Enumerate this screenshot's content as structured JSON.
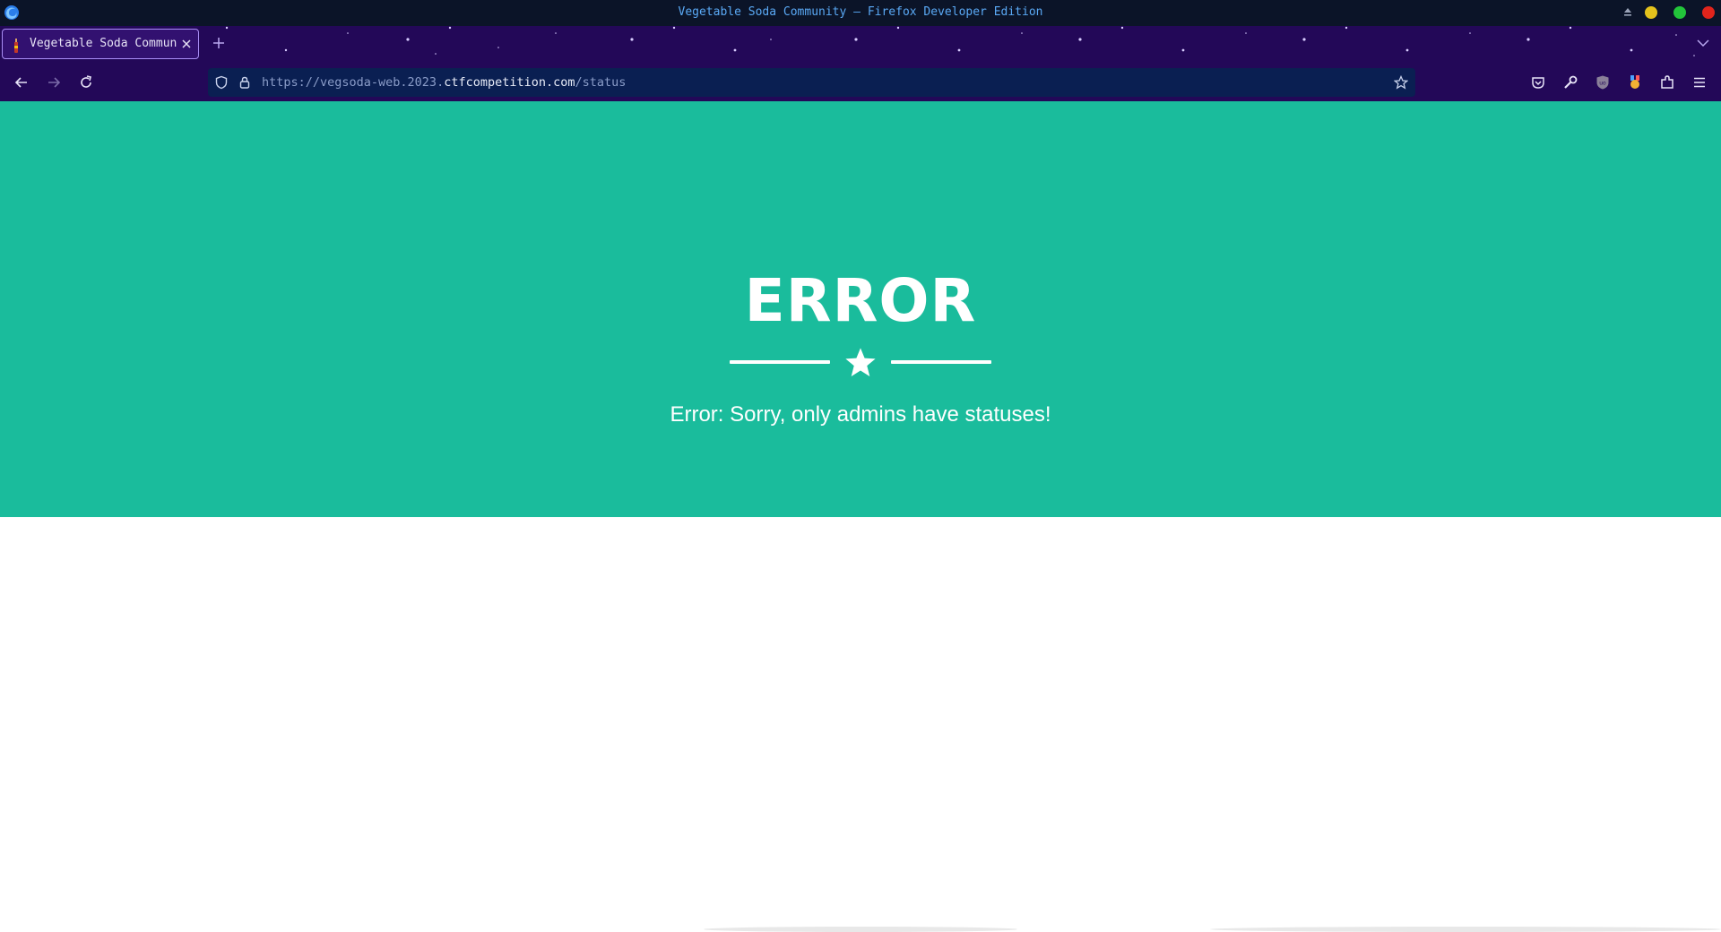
{
  "window": {
    "title": "Vegetable Soda Community — Firefox Developer Edition",
    "controls": [
      "eject-icon",
      "minimize-button",
      "maximize-button",
      "close-button"
    ]
  },
  "colors": {
    "titlebar_bg": "#0b1428",
    "toolbar_bg": "#230858",
    "urlbar_bg": "#0a1f52",
    "hero_bg": "#1abc9c",
    "minimize": "#e4c21c",
    "maximize": "#22c53a",
    "close": "#e0241c"
  },
  "tabs": [
    {
      "title": "Vegetable Soda Community",
      "favicon": "soda-bottle-icon"
    }
  ],
  "urlbar": {
    "url_prefix": "https://vegsoda-web.2023.",
    "url_domain": "ctfcompetition.com",
    "url_path": "/status"
  },
  "page": {
    "heading": "ERROR",
    "message": "Error: Sorry, only admins have statuses!"
  }
}
